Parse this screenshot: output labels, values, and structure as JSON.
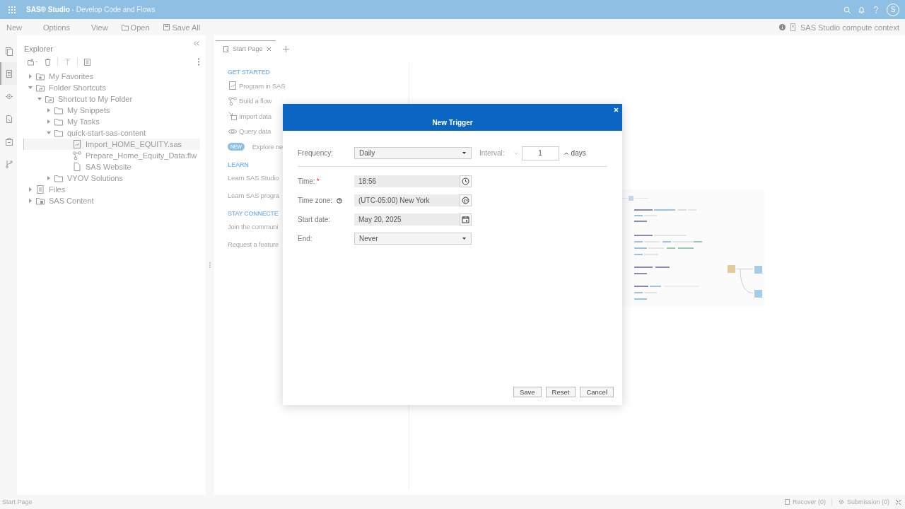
{
  "topbar": {
    "title": "**SAS® Studio** - Develop Code and Flows",
    "avatar": "S"
  },
  "menubar": {
    "items": [
      {
        "label": "New",
        "kind": "text"
      },
      {
        "label": "Options",
        "kind": "text"
      },
      {
        "label": "View",
        "kind": "text"
      },
      {
        "label": "Open",
        "kind": "folder"
      },
      {
        "label": "Save All",
        "kind": "save"
      }
    ],
    "context": "SAS Studio compute context"
  },
  "rail": [
    {
      "kind": "pages",
      "selected": false
    },
    {
      "kind": "explorer",
      "selected": true
    },
    {
      "kind": "libraries",
      "selected": false
    },
    {
      "kind": "snippets",
      "selected": false
    },
    {
      "kind": "tasks",
      "selected": false
    },
    {
      "kind": "git",
      "selected": false
    }
  ],
  "explorer": {
    "title": "Explorer",
    "tree": [
      {
        "label": "My Favorites",
        "kind": "favorites",
        "expanded": false,
        "selected": false
      },
      {
        "label": "Folder Shortcuts",
        "kind": "shortcut",
        "expanded": true,
        "selected": false,
        "children": [
          {
            "label": "Shortcut to My Folder",
            "kind": "shortcut",
            "expanded": true,
            "selected": false,
            "children": [
              {
                "label": "My Snippets",
                "kind": "folder",
                "expanded": false,
                "selected": false
              },
              {
                "label": "My Tasks",
                "kind": "folder",
                "expanded": false,
                "selected": false
              },
              {
                "label": "quick-start-sas-content",
                "kind": "folder",
                "expanded": true,
                "selected": false,
                "children": [
                  {
                    "label": "Import_HOME_EQUITY.sas",
                    "kind": "program",
                    "selected": true
                  },
                  {
                    "label": "Prepare_Home_Equity_Data.flw",
                    "kind": "flow",
                    "selected": false
                  },
                  {
                    "label": "SAS Website",
                    "kind": "file",
                    "selected": false
                  }
                ]
              },
              {
                "label": "VYOV Solutions",
                "kind": "folder",
                "expanded": false,
                "selected": false
              }
            ]
          }
        ]
      },
      {
        "label": "Files",
        "kind": "files",
        "expanded": false,
        "selected": false
      },
      {
        "label": "SAS Content",
        "kind": "content",
        "expanded": false,
        "selected": false
      }
    ]
  },
  "tabs": [
    {
      "label": "Start Page",
      "selected": true
    }
  ],
  "start_page": {
    "sections": [
      {
        "heading": "GET STARTED",
        "items": [
          {
            "label": "Program in SAS",
            "kind": "program"
          },
          {
            "label": "Build a flow",
            "kind": "flow"
          },
          {
            "label": "Import data",
            "kind": "import"
          },
          {
            "label": "Query data",
            "kind": "query"
          },
          {
            "label": "Explore ne",
            "kind": "new",
            "badge": "NEW"
          }
        ]
      },
      {
        "heading": "LEARN",
        "items": [
          {
            "label": "Learn SAS Studio",
            "kind": "link"
          },
          {
            "label": "Learn SAS progra",
            "kind": "link"
          }
        ]
      },
      {
        "heading": "STAY CONNECTE",
        "items": [
          {
            "label": "Join the communi",
            "kind": "link"
          },
          {
            "label": "Request a feature",
            "kind": "link"
          }
        ]
      }
    ]
  },
  "dialog": {
    "title": "New Trigger",
    "frequency": {
      "label": "Frequency:",
      "value": "Daily"
    },
    "interval": {
      "label": "Interval:",
      "value": "1",
      "unit": "days"
    },
    "fields": [
      {
        "label": "Time:",
        "kind": "time",
        "value": "18:56",
        "marker": "*",
        "help": false
      },
      {
        "label": "Time zone:",
        "kind": "timezone",
        "value": "(UTC-05:00) New York",
        "help": true
      },
      {
        "label": "Start date:",
        "kind": "date",
        "value": "May 20, 2025",
        "help": false
      },
      {
        "label": "End:",
        "kind": "select",
        "value": "Never",
        "help": false
      }
    ],
    "buttons": [
      "Save",
      "Reset",
      "Cancel"
    ]
  },
  "status_bar": {
    "page": "Start Page",
    "recover": "Recover (0)",
    "submission": "Submission (0)"
  }
}
